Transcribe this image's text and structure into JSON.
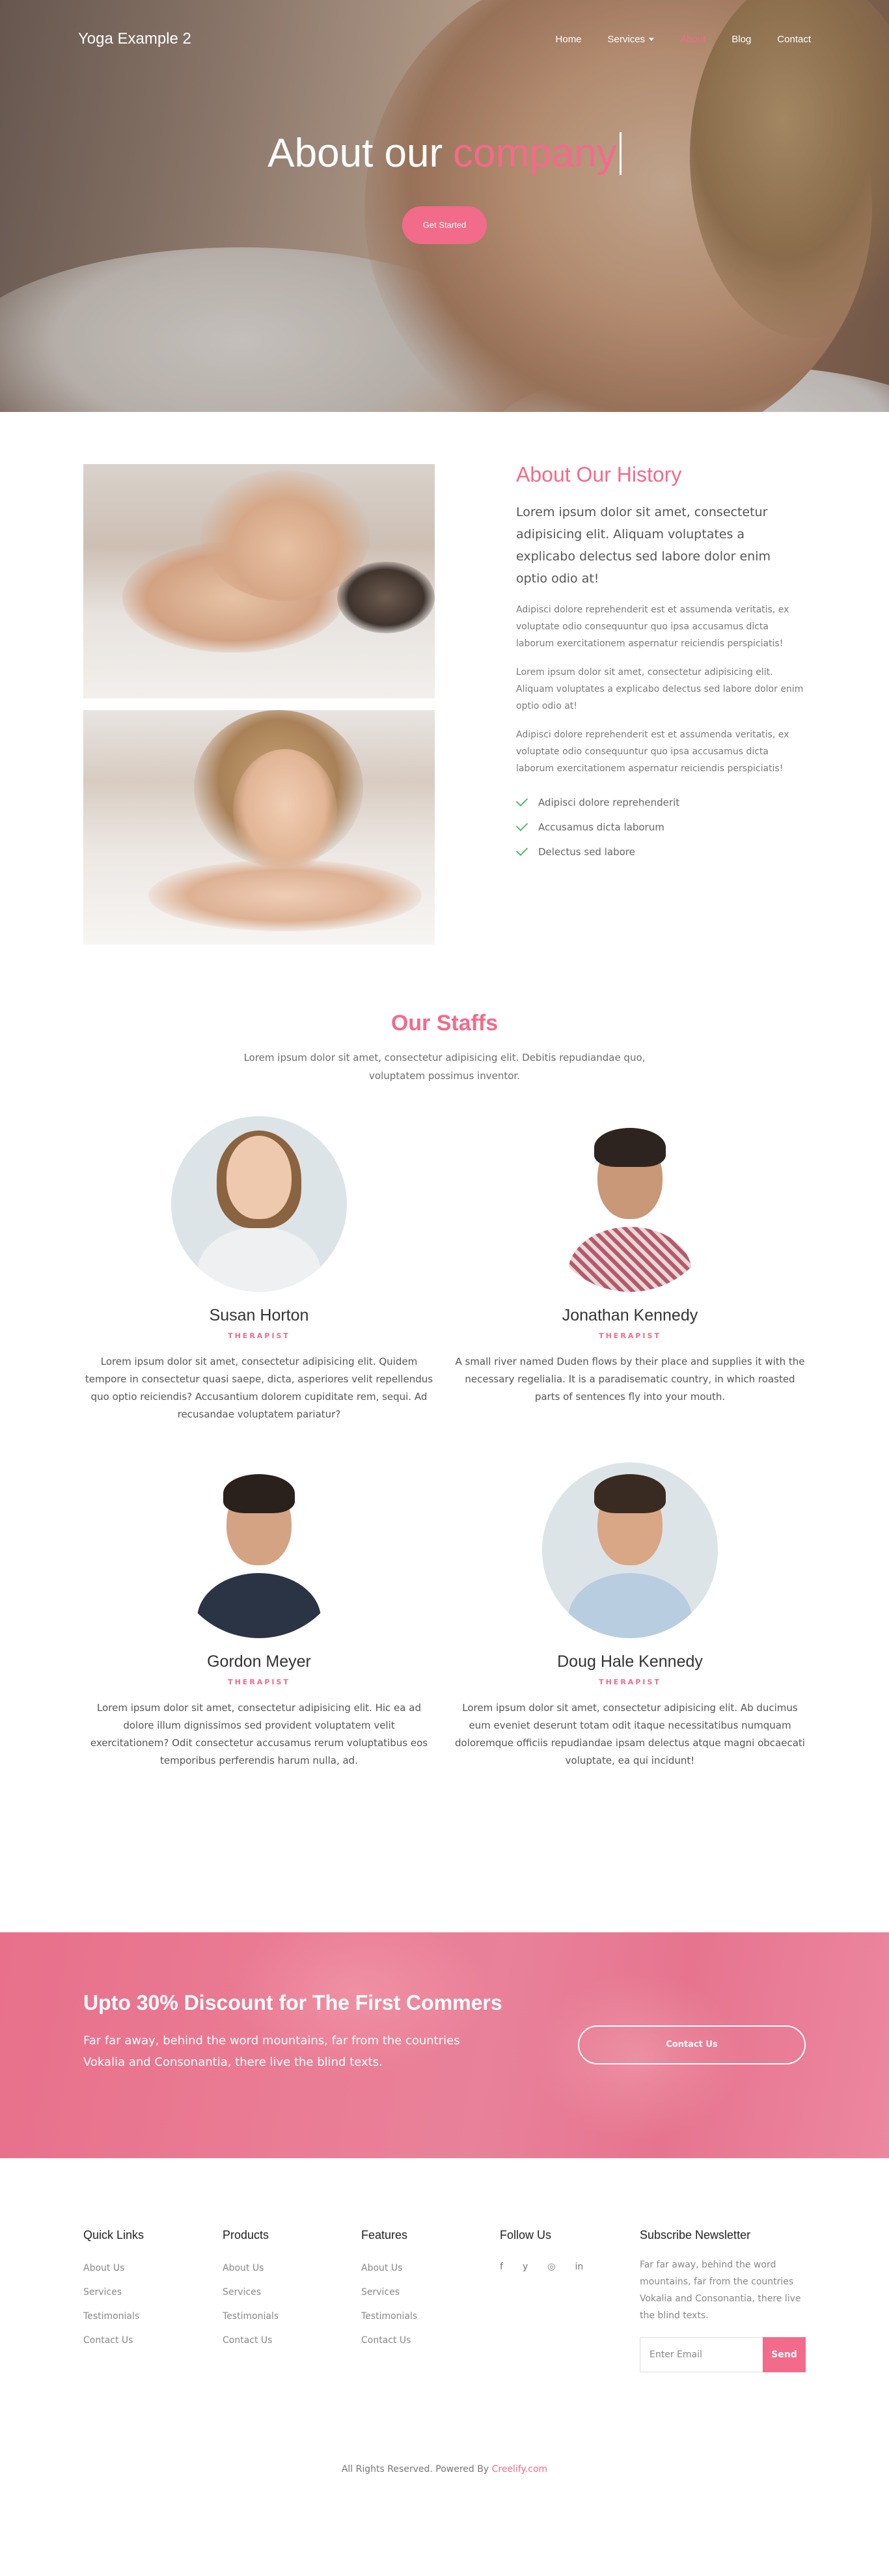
{
  "nav": {
    "brand": "Yoga Example 2",
    "items": [
      {
        "label": "Home",
        "active": false,
        "has_dropdown": false
      },
      {
        "label": "Services",
        "active": false,
        "has_dropdown": true
      },
      {
        "label": "About",
        "active": true,
        "has_dropdown": false
      },
      {
        "label": "Blog",
        "active": false,
        "has_dropdown": false
      },
      {
        "label": "Contact",
        "active": false,
        "has_dropdown": false
      }
    ]
  },
  "hero": {
    "title_plain": "About our",
    "title_accent": "company",
    "cta_label": "Get Started"
  },
  "about": {
    "title": "About Our History",
    "lead": "Lorem ipsum dolor sit amet, consectetur adipisicing elit. Aliquam voluptates a explicabo delectus sed labore dolor enim optio odio at!",
    "paragraphs": [
      "Adipisci dolore reprehenderit est et assumenda veritatis, ex voluptate odio consequuntur quo ipsa accusamus dicta laborum exercitationem aspernatur reiciendis perspiciatis!",
      "Lorem ipsum dolor sit amet, consectetur adipisicing elit. Aliquam voluptates a explicabo delectus sed labore dolor enim optio odio at!",
      "Adipisci dolore reprehenderit est et assumenda veritatis, ex voluptate odio consequuntur quo ipsa accusamus dicta laborum exercitationem aspernatur reiciendis perspiciatis!"
    ],
    "checklist": [
      "Adipisci dolore reprehenderit",
      "Accusamus dicta laborum",
      "Delectus sed labore"
    ]
  },
  "staff": {
    "title": "Our Staffs",
    "subtitle": "Lorem ipsum dolor sit amet, consectetur adipisicing elit. Debitis repudiandae quo, voluptatem possimus inventor.",
    "members": [
      {
        "name": "Susan Horton",
        "role": "THERAPIST",
        "bio": "Lorem ipsum dolor sit amet, consectetur adipisicing elit. Quidem tempore in consectetur quasi saepe, dicta, asperiores velit repellendus quo optio reiciendis? Accusantium dolorem cupiditate rem, sequi. Ad recusandae voluptatem pariatur?"
      },
      {
        "name": "Jonathan Kennedy",
        "role": "THERAPIST",
        "bio": "A small river named Duden flows by their place and supplies it with the necessary regelialia. It is a paradisematic country, in which roasted parts of sentences fly into your mouth."
      },
      {
        "name": "Gordon Meyer",
        "role": "THERAPIST",
        "bio": "Lorem ipsum dolor sit amet, consectetur adipisicing elit. Hic ea ad dolore illum dignissimos sed provident voluptatem velit exercitationem? Odit consectetur accusamus rerum voluptatibus eos temporibus perferendis harum nulla, ad."
      },
      {
        "name": "Doug Hale Kennedy",
        "role": "THERAPIST",
        "bio": "Lorem ipsum dolor sit amet, consectetur adipisicing elit. Ab ducimus eum eveniet deserunt totam odit itaque necessitatibus numquam doloremque officiis repudiandae ipsam delectus atque magni obcaecati voluptate, ea qui incidunt!"
      }
    ]
  },
  "promo": {
    "title": "Upto 30% Discount for The First Commers",
    "text": "Far far away, behind the word mountains, far from the countries Vokalia and Consonantia, there live the blind texts.",
    "button": "Contact Us"
  },
  "footer": {
    "columns": [
      {
        "title": "Quick Links",
        "links": [
          "About Us",
          "Services",
          "Testimonials",
          "Contact Us"
        ]
      },
      {
        "title": "Products",
        "links": [
          "About Us",
          "Services",
          "Testimonials",
          "Contact Us"
        ]
      },
      {
        "title": "Features",
        "links": [
          "About Us",
          "Services",
          "Testimonials",
          "Contact Us"
        ]
      }
    ],
    "follow_title": "Follow Us",
    "social_icons": [
      {
        "name": "facebook-icon",
        "glyph": "f"
      },
      {
        "name": "twitter-icon",
        "glyph": "y"
      },
      {
        "name": "instagram-icon",
        "glyph": "◎"
      },
      {
        "name": "linkedin-icon",
        "glyph": "in"
      }
    ],
    "newsletter_title": "Subscribe Newsletter",
    "newsletter_text": "Far far away, behind the word mountains, far from the countries Vokalia and Consonantia, there live the blind texts.",
    "email_placeholder": "Enter Email",
    "send_label": "Send",
    "copyright_prefix": "All Rights Reserved. Powered By",
    "copyright_brand": "Creelify.com"
  },
  "colors": {
    "accent": "#f26b8a",
    "promo_bg": "#e9819a",
    "check": "#58b87a"
  }
}
